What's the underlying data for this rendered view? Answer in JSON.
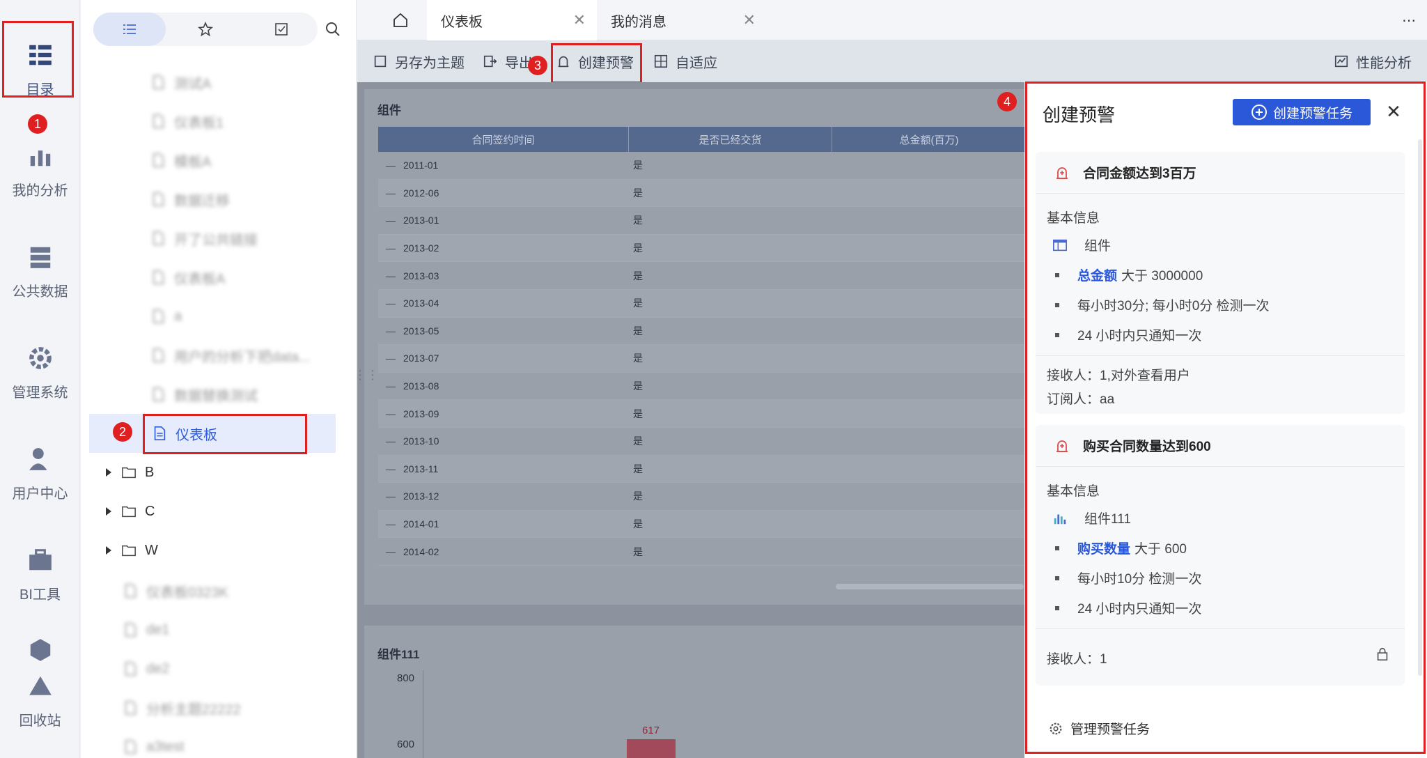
{
  "rail": {
    "items": [
      {
        "label": "目录",
        "icon": "catalog-icon"
      },
      {
        "label": "我的分析",
        "icon": "analysis-icon"
      },
      {
        "label": "公共数据",
        "icon": "public-data-icon"
      },
      {
        "label": "管理系统",
        "icon": "settings-gear-icon"
      },
      {
        "label": "用户中心",
        "icon": "user-icon"
      },
      {
        "label": "BI工具",
        "icon": "toolbox-icon"
      },
      {
        "label": "回收站",
        "icon": "recycle-bin-icon"
      }
    ]
  },
  "catalog": {
    "blurred_top": [
      "测试A",
      "仪表板1",
      "模板A",
      "数据迁移",
      "开了公共链接",
      "仪表板A",
      "a",
      "用户的分析下把data...",
      "数据替换测试"
    ],
    "selected": "仪表板",
    "folders": [
      "B",
      "C",
      "W"
    ],
    "blurred_bottom": [
      "仪表板0323K",
      "de1",
      "de2",
      "分析主题22222",
      "a3test"
    ]
  },
  "tabs": {
    "home_icon": "home-icon",
    "items": [
      {
        "label": "仪表板",
        "active": true
      },
      {
        "label": "我的消息",
        "active": false
      }
    ]
  },
  "toolbar": {
    "save_as_topic": "另存为主题",
    "export": "导出",
    "create_alert": "创建预警",
    "adaptive": "自适应",
    "performance": "性能分析"
  },
  "dashboard": {
    "widget1_title": "组件",
    "widget2_title": "组件111",
    "table": {
      "headers": [
        "合同签约时间",
        "是否已经交货",
        "总金额(百万)"
      ],
      "rows": [
        [
          "2011-01",
          "是"
        ],
        [
          "2012-06",
          "是"
        ],
        [
          "2013-01",
          "是"
        ],
        [
          "2013-02",
          "是"
        ],
        [
          "2013-03",
          "是"
        ],
        [
          "2013-04",
          "是"
        ],
        [
          "2013-05",
          "是"
        ],
        [
          "2013-07",
          "是"
        ],
        [
          "2013-08",
          "是"
        ],
        [
          "2013-09",
          "是"
        ],
        [
          "2013-10",
          "是"
        ],
        [
          "2013-11",
          "是"
        ],
        [
          "2013-12",
          "是"
        ],
        [
          "2014-01",
          "是"
        ],
        [
          "2014-02",
          "是"
        ]
      ]
    },
    "chart": {
      "y_ticks": [
        "800",
        "600"
      ],
      "bar_label": "617"
    }
  },
  "panel": {
    "title": "创建预警",
    "create_button": "创建预警任务",
    "alerts": [
      {
        "name": "合同金额达到3百万",
        "section": "基本信息",
        "widget": "组件",
        "metric": "总金额",
        "condition": "大于 3000000",
        "schedule": "每小时30分; 每小时0分 检测一次",
        "notify": "24 小时内只通知一次",
        "receivers": "接收人：1,对外查看用户",
        "subscribers": "订阅人：aa"
      },
      {
        "name": "购买合同数量达到600",
        "section": "基本信息",
        "widget": "组件111",
        "metric": "购买数量",
        "condition": "大于 600",
        "schedule": "每小时10分 检测一次",
        "notify": "24 小时内只通知一次",
        "receivers": "接收人：1"
      }
    ],
    "manage": "管理预警任务"
  },
  "badges": [
    "1",
    "2",
    "3",
    "4"
  ],
  "colors": {
    "accent": "#2a58d8",
    "highlight": "#e02020",
    "table_header": "#55698f"
  }
}
